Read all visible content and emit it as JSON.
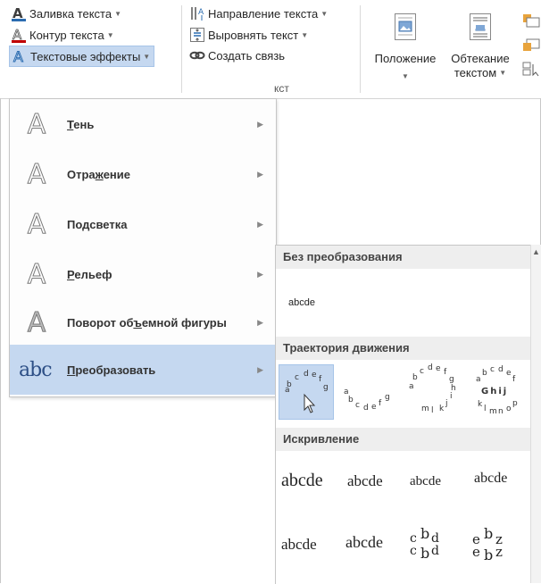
{
  "ribbon": {
    "text_fill": {
      "label": "Заливка текста",
      "icon": "text-fill-icon",
      "color": "#2b6cb0"
    },
    "text_outline": {
      "label": "Контур текста",
      "icon": "text-outline-icon",
      "color": "#c00000"
    },
    "text_effects": {
      "label": "Текстовые эффекты",
      "icon": "text-effects-icon"
    },
    "text_direction": {
      "label": "Направление текста",
      "icon": "text-direction-icon"
    },
    "align_text": {
      "label": "Выровнять текст",
      "icon": "align-text-icon"
    },
    "create_link": {
      "label": "Создать связь",
      "icon": "link-icon"
    },
    "position": {
      "label": "Положение",
      "icon": "position-icon"
    },
    "wrap_text": {
      "label": "Обтекание",
      "label2": "текстом",
      "icon": "wrap-text-icon"
    },
    "group_label_fragment": "кст"
  },
  "effects_menu": {
    "items": [
      {
        "label": "Тень",
        "accel": "Т",
        "rest": "ень",
        "icon": "shadow-icon"
      },
      {
        "label": "Отражение",
        "accel": "ж",
        "pre": "Отра",
        "rest": "ение",
        "icon": "reflection-icon"
      },
      {
        "label": "Подсветка",
        "accel": "д",
        "pre": "По",
        "rest": "светка",
        "icon": "glow-icon"
      },
      {
        "label": "Рельеф",
        "accel": "Р",
        "rest": "ельеф",
        "icon": "bevel-icon"
      },
      {
        "label": "Поворот объемной фигуры",
        "accel": "ъ",
        "pre": "Поворот об",
        "rest": "емной фигуры",
        "icon": "3d-rotation-icon"
      },
      {
        "label": "Преобразовать",
        "accel": "П",
        "rest": "реобразовать",
        "icon": "transform-icon",
        "selected": true
      }
    ]
  },
  "transform_gallery": {
    "sections": {
      "no_transform": "Без преобразования",
      "follow_path": "Траектория движения",
      "warp": "Искривление"
    },
    "no_transform_sample": "abcde",
    "warp_samples_row1": [
      "abcde",
      "abcde",
      "abcde",
      "abcde"
    ],
    "warp_samples_row2": [
      "abcde",
      "abcde",
      "abcde",
      "abcde"
    ],
    "path_samples": [
      "abcdefg",
      "abcdefg",
      "abcdefghijklm",
      "abcdefghijklmno"
    ]
  },
  "colors": {
    "selection": "#c5d8f0",
    "selection_border": "#a6c4e8",
    "header_bg": "#eeeeee"
  }
}
